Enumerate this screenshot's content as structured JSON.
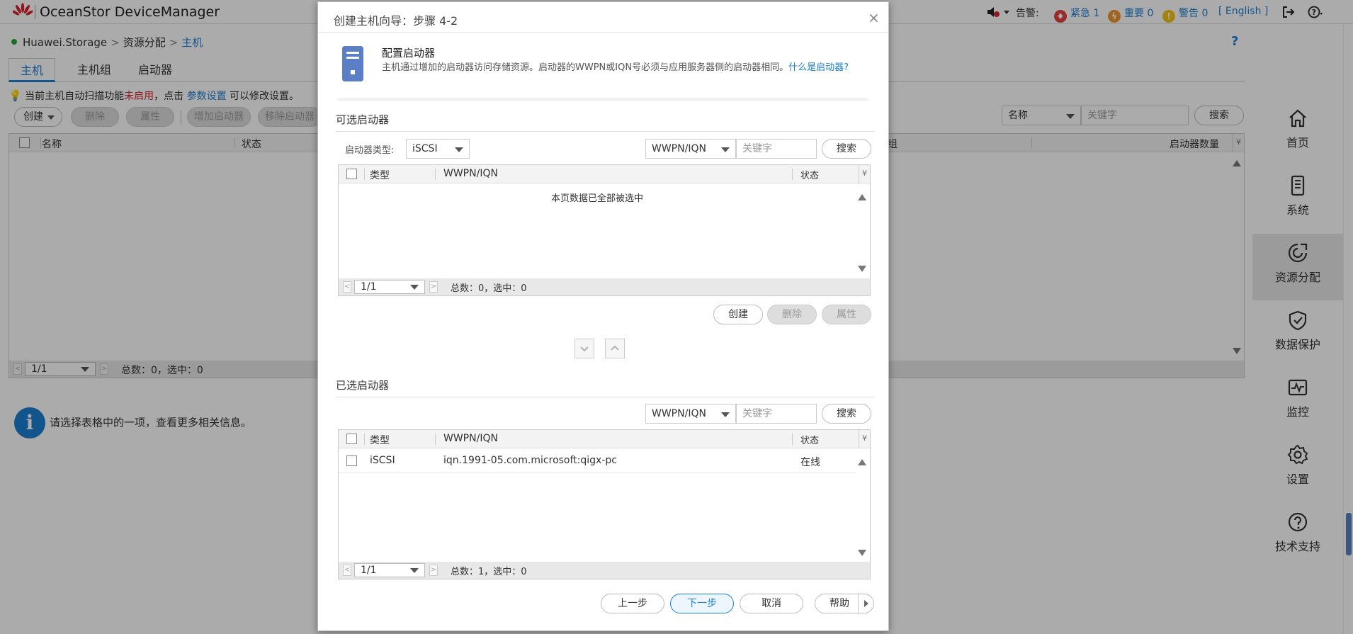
{
  "app": {
    "name": "OceanStor DeviceManager",
    "alarm_label": "告警:",
    "urgent": "紧急 1",
    "major": "重要 0",
    "warning": "警告 0",
    "language": "[ English ]"
  },
  "breadcrumb": {
    "root": "Huawei.Storage",
    "level1": "资源分配",
    "current": "主机"
  },
  "tabs": [
    "主机",
    "主机组",
    "启动器"
  ],
  "notice": {
    "prefix": "当前主机自动扫描功能",
    "status": "未启用",
    "middle": "，点击",
    "link": "参数设置",
    "suffix": "可以修改设置。"
  },
  "toolbar": {
    "create": "创建",
    "delete": "删除",
    "properties": "属性",
    "add_initiator": "增加启动器",
    "remove_initiator": "移除启动器"
  },
  "main_search": {
    "field": "名称",
    "placeholder": "关键字",
    "button": "搜索"
  },
  "main_table": {
    "col_name": "名称",
    "col_status": "状态",
    "col_group_tail": "组",
    "col_initiator_count": "启动器数量",
    "page": "1/1",
    "summary": "总数：0，选中：0"
  },
  "info": "请选择表格中的一项，查看更多相关信息。",
  "nav": [
    "首页",
    "系统",
    "资源分配",
    "数据保护",
    "监控",
    "设置",
    "技术支持"
  ],
  "dialog": {
    "title": "创建主机向导：步骤 4-2",
    "close": "×",
    "step_name": "配置启动器",
    "step_desc": "主机通过增加的启动器访问存储资源。启动器的WWPN或IQN号必须与应用服务器侧的启动器相同。",
    "step_link": "什么是启动器?",
    "available": {
      "section": "可选启动器",
      "type_label": "启动器类型:",
      "type_value": "iSCSI",
      "search_field": "WWPN/IQN",
      "search_placeholder": "关键字",
      "search_button": "搜索",
      "col_type": "类型",
      "col_wwpn": "WWPN/IQN",
      "col_status": "状态",
      "empty_text": "本页数据已全部被选中",
      "page": "1/1",
      "summary": "总数：0，选中：0",
      "create": "创建",
      "delete": "删除",
      "properties": "属性"
    },
    "selected": {
      "section": "已选启动器",
      "search_field": "WWPN/IQN",
      "search_placeholder": "关键字",
      "search_button": "搜索",
      "col_type": "类型",
      "col_wwpn": "WWPN/IQN",
      "col_status": "状态",
      "rows": [
        {
          "type": "iSCSI",
          "wwpn": "iqn.1991-05.com.microsoft:qigx-pc",
          "status": "在线"
        }
      ],
      "page": "1/1",
      "summary": "总数：1，选中：0"
    },
    "footer": {
      "prev": "上一步",
      "next": "下一步",
      "cancel": "取消",
      "help": "帮助"
    }
  },
  "colors": {
    "accent": "#1c7fd2",
    "danger": "#d9232d",
    "online": "#27a53b"
  }
}
